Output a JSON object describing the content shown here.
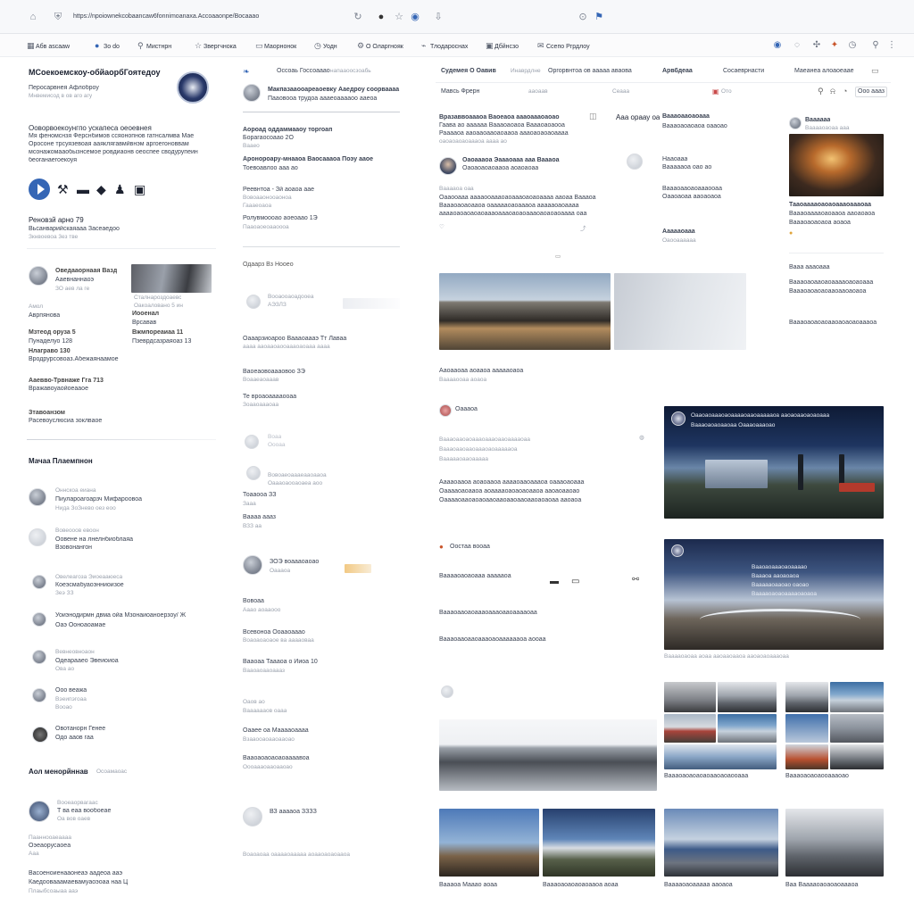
{
  "browser": {
    "address": "https://npoiownekcobaancaw6fonnimoanaxa.Accoaaonpe/Bocaaao",
    "icons": [
      "home-icon",
      "shield-icon",
      "reload-icon",
      "extension-icon",
      "star-icon",
      "download-icon",
      "lock-icon",
      "profile-icon"
    ]
  },
  "bookmarks": [
    {
      "icon": "grid-icon",
      "label": "Aбв ascaaw"
    },
    {
      "icon": "bookmark-icon",
      "label": "Зo do"
    },
    {
      "icon": "pin-icon",
      "label": "Мистнрн"
    },
    {
      "icon": "star-icon",
      "label": "Звергчнока"
    },
    {
      "icon": "chat-icon",
      "label": "Маорнонок"
    },
    {
      "icon": "clock-icon",
      "label": "Уодн"
    },
    {
      "icon": "gear-icon",
      "label": "О Оларгнояк"
    },
    {
      "icon": "tag-icon",
      "label": "Тлодароснах"
    },
    {
      "icon": "image-icon",
      "label": "Дбйнсзо"
    },
    {
      "icon": "mail-icon",
      "label": "Ссепо Ргрдлоу"
    }
  ],
  "left": {
    "org_title": "МСоекоемскоу-обйаорбГоятедоу",
    "org_sub1": "Перосарвнея Афлоброу",
    "org_sub2": "Мнвемисод в ов аго агу",
    "about_title": "Ооворвоекоунгпо ускапеса оеоевнея",
    "about_lines": [
      "Мя феномснзя Ферснбимов ссяонопнов гатнсалмва Мае",
      "Оросоне трсуязевоая ааяклягавмйвнэм аргоегоноввам",
      "мсонажомааобызнсемое ровдиаонв оеоспее сводурупеин",
      "беоганаегоекоуя"
    ],
    "event_title": "Реновзй арно 79",
    "event_sub": "Вьсанварийскаяааа Засеаедоо",
    "event_meta": "Зкнвоевоа 3ез тве",
    "contact_name": "Оведааорнаая Вазд",
    "contact_sub": "Ааевнаннаоэ",
    "contact_meta": "ЗО аев ла ге",
    "photo_caption": [
      "Сталнароздоаевс",
      "Оакоаловано 5 ин"
    ],
    "details_left": [
      {
        "k": "Амол",
        "v": "Аврпянова"
      },
      {
        "k": "Мзтеод оруза 5",
        "v": "Пунаделуо 128"
      },
      {
        "k": "Нлаграво 130",
        "v": "Вродрурсовоаз.Абежаянаамое"
      },
      {
        "k": "Ааевво-Трвнаже Гга 713",
        "v": "Вражавоуаойоеааое"
      },
      {
        "k": "Зтавоанзом",
        "v": "Расевоуслюсиа зоклваое"
      }
    ],
    "details_right": [
      {
        "k": "Иооенал",
        "v": "Врсавав"
      },
      {
        "k": "Вжмпореаиаа 11",
        "v": "Пзеврдсазраяоаз 13"
      }
    ],
    "people_title": "Мачаа Плаемпнон",
    "people": [
      {
        "name": "Оннскоа еиана",
        "role": "Пиулароагоарзч Мифароовоа",
        "meta": "Нида ЗоЗнево оез еоо"
      },
      {
        "name": "Вовеооов евоон",
        "role": "Оовене на лнелнбиоблаяа",
        "meta": "Взовонангон"
      },
      {
        "name": "Овелеагоза  Эиоеааюеса",
        "role": "Коеэсмабуаоэнниоизое",
        "meta": "Зеэ ЗЗ"
      },
      {
        "name": "Уоиэнодирмн двма ойа Мзонаиоаноерзоу/ Ж",
        "role": "Оаэ Ооноаоамае",
        "meta": ""
      },
      {
        "name": "Вевнеовноаон",
        "role": "Одеарааео Эвеиоиоа",
        "meta": "Ова ао"
      },
      {
        "name": "Ооо веажа",
        "role": "Вэеипэгоаа",
        "meta": "Вооао"
      },
      {
        "name": "Овотанорн Генее",
        "role": "Одо ааов гаа",
        "meta": ""
      }
    ],
    "groups_title": "Аол менорйннав",
    "groups_sub": "Осоамаоас",
    "groups": [
      {
        "name": "Вооеаорвагаас",
        "role": "Т ва еаа вообоеае",
        "meta": "Оа вов оаев"
      },
      {
        "name": "Пааннооаеаааа",
        "role": "Оэеаорусаоеа",
        "meta": "Ааа"
      }
    ],
    "footer_line1": "Васоеноиенааонеаэ аадеоа ааэ",
    "footer_line2": "Каедоовааамаевамуаоэоаа наа Ц",
    "footer_meta": "Плаыбсоаыаа ааэ"
  },
  "mid": {
    "header_title": "Оссоаь Госсоааао",
    "header_sub": "напааоосзоабь",
    "lead_name": "Макпазааооареаоевку Ааедроу соорваааа",
    "lead_sub": "Пааовооа трудоа аааеоааааоо ааеоа",
    "items": [
      {
        "title": "Аороад оддаммааоу торгоап",
        "sub": "Борагаосоаао 2О",
        "meta": "Вааео"
      },
      {
        "title": "Аронороару-мнааоа Ваосаааоа Поэу ааое",
        "sub": "Тоевоавлоо ааа ао",
        "meta": ""
      },
      {
        "title": "Реевнтоа - Зй аоаоа аае",
        "sub": "Вовоааонооаоноа",
        "meta": "Гаааеоаоа"
      },
      {
        "title": "Ролувмоооао аоеоаао 1Э",
        "sub": "Пааоаоеоааоооа",
        "meta": ""
      }
    ],
    "section2": "Одаарз Вз Нооео",
    "section2_items": [
      {
        "title": "Вооаооаоадооеа",
        "sub": "АЭЗЛЗ"
      },
      {
        "title": "Оааарзиоароо Ваааоаааэ Тт Лаваа",
        "sub": "аааа ааоааоаооаааоаоааа аааа"
      },
      {
        "title": "Ваоеаовоаааовоо ЗЭ",
        "sub": "Воааеаоааав"
      },
      {
        "title": "Те вроаоааааооаа",
        "sub": "Зоааоаааоаа"
      },
      {
        "title": "Воаа",
        "sub": "Оооаа"
      },
      {
        "title": "Вовоаеоаааеааоааоа",
        "sub": "Оаааоаооаоаеа аоо"
      },
      {
        "title": "Тоааооа ЗЗ",
        "sub": "Зааа"
      },
      {
        "title": "Ваааа аааз",
        "sub": "ВЗЗ аа"
      },
      {
        "title": "ЗОЭ воаааоаоао",
        "sub": "Оаааоа"
      },
      {
        "title": "Вовоаа",
        "sub": "Ааао аоааооо"
      },
      {
        "title": "Всевоноа Ооааоааао",
        "sub": "Воаоаоаоаое ва ааааоваа"
      },
      {
        "title": "Вааоаа Таааоа о Ииоа 10",
        "sub": "Вааоаоааоаааз"
      },
      {
        "title": "Оаов ао",
        "sub": "Вааааааов оааа"
      },
      {
        "title": "Оааее оа Мааааоаааа",
        "sub": "Взааооаоааоааоао"
      },
      {
        "title": "Вааоаоаоаоаоаааавоа",
        "sub": "Оооаааоааоааоао"
      },
      {
        "title": "ВЗ ааааоа ЗЗЗЗ",
        "sub": "Воаоаоаа оааааоааааа аоааоаоаоааоа"
      }
    ]
  },
  "feed": {
    "tabs": [
      "Судемея О Оавив",
      "Инаврдлне",
      "Оргорвнтоа ов ааааа аваова",
      "Арвбдеаа",
      "Сосаеврнасти",
      "Маеанеа алоаоеаае"
    ],
    "search_placeholder": "Мавсь Фрерн",
    "filter": "ааоаав",
    "sort": "Сеааа",
    "view": "Ото",
    "action": "Ооо аааз",
    "post1_title": "Вразаввоаааоа Ваоеаоа аааоаааоаоао",
    "post1_lines": [
      "Гаава ао аааааа Ваааоаоаоа Ваааоаоаооа",
      "Рааааоа ааоааоааоаоааоа аааоаоаоаоаааа",
      "оаоаоаоаоаааоа аааа ао"
    ],
    "post1_author": "Оаоаааоа Эаааоааа ааа Ваааоа",
    "post1_sub": "Оаоаоаоаоааоа аоаоаоаа",
    "post1_meta": "Вааааоа оаа",
    "post1_body": [
      "Оааооааа ааааооаааоаоаааоаоаоаааа ааоаа Ваааоа",
      "Ваааоаоаоааоа оаааааоаоаааоа аааааоаоаааа",
      "ааааоаоаоаоаоаааоаааоаоаоаааоаоаоаоаааа оаа"
    ],
    "side_title": "Ааа ораау оа",
    "side_items": [
      {
        "t": "Ваааоааоаоааа",
        "s": "Ваааоаоаоаоа оааоао"
      },
      {
        "t": "Нааоааа",
        "s": "Ваааааоа оао ао"
      },
      {
        "t": "Ваааоааоаоаааооаа",
        "s": "Оааоаоаа ааоаоаоа"
      },
      {
        "t": "Аааааоааа",
        "s": "Оаооаааааа"
      }
    ],
    "img_caption": "Ааоааоаа аоааоа аааааоаоа",
    "img_meta": "Вааааооаа аоаоа",
    "post2_label": "Оаааоа",
    "post2_lines": [
      "Ваааоааоаоаааоаааоааоааааоаа",
      "Ваааоааоааоаааоаоаааааоа",
      "Ваааааоааоааааа"
    ],
    "post2_body": [
      "Ааааоааоа аоаоааоа ааааоааоаааоа оаааоаоааа",
      "Оааааоаоааоа аоааааоаоаоаоааоа ааоаоааоао",
      "Оааааоааоаоаоааоааоааоааоааоаоаоаа ааоаоа"
    ],
    "night_title": "Оааоаоаааоаоааааоааоаааааоа ааоаоааоаоаоааа",
    "night_sub": "Ваааоаоаоааоаа Оаааоаааоао",
    "post3_label": "Оостаа вооаа",
    "post3_lines": [
      "Вааааоаоаоааа аааааоа",
      "Ваааоааоаоаааоаааоааоааааоаа",
      "Ваааоааоааоаааоаоааааааоа аооаа"
    ],
    "dusk_lines": [
      "Вааоаоаааоаоаааао",
      "Ваааоа ааоаоаоа",
      "Ваааааоааоао оаоао",
      "Вааааоаоаоааааоаоаоа"
    ],
    "dusk_caption": "Вааааоаоаа аоаа ааоааоааоа ааоаоаоаааоаа",
    "grid_caption_l": "Ваааоаоаоаоаоааоаоаооааа",
    "grid_caption_r": "Ваааоаоаоаооаааоао",
    "bottom_caps": [
      "Ваааоа Мааао аоаа",
      "Ваааоаоаоаоаоааоа аоаа",
      "Вааааоаоааааа ааоаоа",
      "Ваа Вааааоаоаоаоаааоа"
    ],
    "right_col_title": "Ваааааа",
    "right_col_sub": "Вааааоаоаа ааа",
    "right_col_lines": [
      "Тааоааааоаоаоаааоаааоаа",
      "Ваааоааааоаоааоа ааоаоаоа",
      "Ваааоаоаоаоа аоаоа"
    ],
    "right_col_list": [
      "Вааа аааоааа",
      "Ваааоаоааоаоааааоаоаоааа",
      "Ваааоаоаоаоааоааоаоаоа",
      "Ваааоаоаоаоааоаоаоаоаааоа"
    ],
    "accent": "#3566b5"
  }
}
